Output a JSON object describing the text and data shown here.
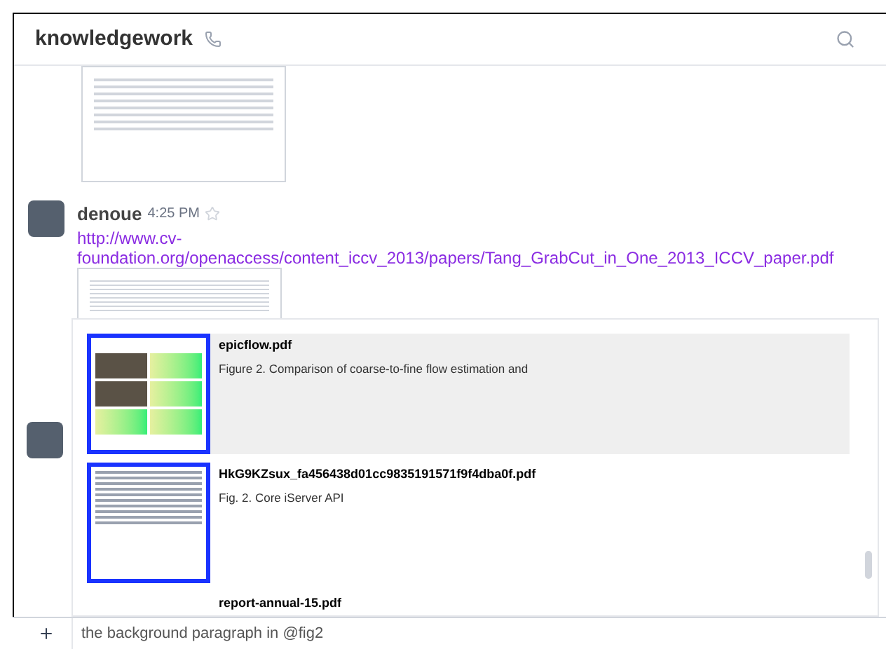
{
  "channel": {
    "title": "knowledgework"
  },
  "messages": [
    {
      "kind": "attachment"
    },
    {
      "kind": "message",
      "author": "denoue",
      "time": "4:25 PM",
      "starred": false,
      "link": "http://www.cv-foundation.org/openaccess/content_iccv_2013/papers/Tang_GrabCut_in_One_2013_ICCV_paper.pdf"
    }
  ],
  "suggestions": [
    {
      "kind": "figure",
      "file": "epicflow.pdf",
      "caption": "Figure 2. Comparison of coarse-to-fine flow estimation and",
      "selected": true
    },
    {
      "kind": "document",
      "file": "HkG9KZsux_fa456438d01cc9835191571f9f4dba0f.pdf",
      "caption": "Fig. 2. Core iServer API",
      "selected": false
    },
    {
      "kind": "partial",
      "file": "report-annual-15.pdf",
      "selected": false
    }
  ],
  "composer": {
    "value": "the background paragraph in @fig2"
  }
}
